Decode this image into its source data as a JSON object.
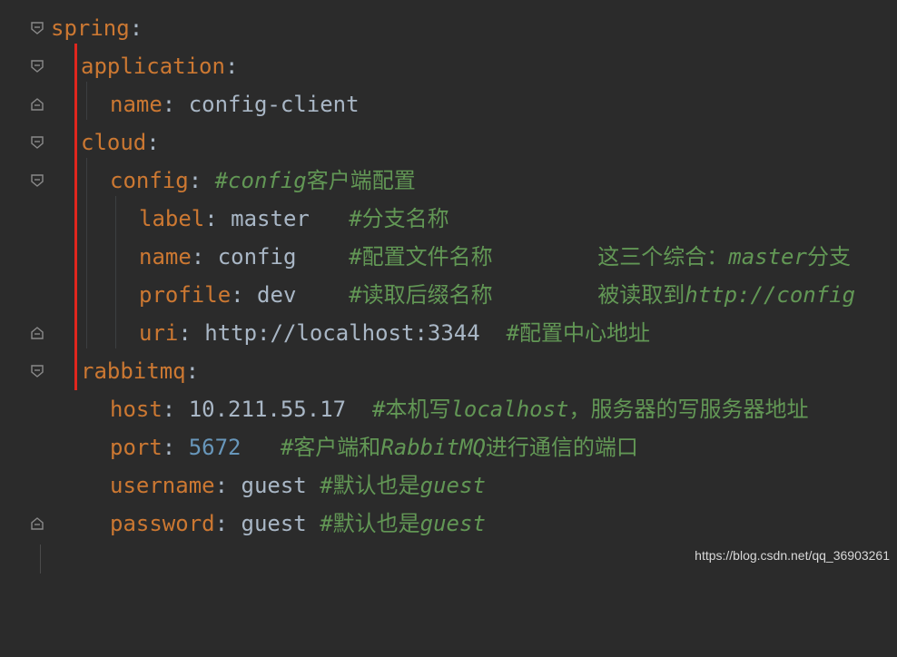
{
  "lines": [
    {
      "key": "spring",
      "colon": ":",
      "value": "",
      "comment": ""
    },
    {
      "key": "application",
      "colon": ":",
      "value": "",
      "comment": ""
    },
    {
      "key": "name",
      "colon": ":",
      "value": " config-client",
      "comment": ""
    },
    {
      "key": "cloud",
      "colon": ":",
      "value": "",
      "comment": ""
    },
    {
      "key": "config",
      "colon": ":",
      "value": " ",
      "comment_italic": "#config",
      "comment_rest": "客户端配置"
    },
    {
      "key": "label",
      "colon": ":",
      "value": " master   ",
      "comment": "#分支名称"
    },
    {
      "key": "name",
      "colon": ":",
      "value": " config    ",
      "comment": "#配置文件名称",
      "extra_plain": "        这三个综合：",
      "extra_italic": "master",
      "extra_tail": "分支"
    },
    {
      "key": "profile",
      "colon": ":",
      "value": " dev    ",
      "comment": "#读取后缀名称",
      "extra_plain": "        被读取到",
      "extra_italic": "http://config"
    },
    {
      "key": "uri",
      "colon": ":",
      "value": " http://localhost:3344  ",
      "comment": "#配置中心地址"
    },
    {
      "key": "rabbitmq",
      "colon": ":",
      "value": "",
      "comment": ""
    },
    {
      "key": "host",
      "colon": ":",
      "value": " 10.211.55.17  ",
      "comment_a": "#本机写",
      "comment_i": "localhost",
      "comment_b": "，服务器的写服务器地址"
    },
    {
      "key": "port",
      "colon": ":",
      "value": " ",
      "number": "5672",
      "pad": "   ",
      "comment_a": "#客户端和",
      "comment_i": "RabbitMQ",
      "comment_b": "进行通信的端口"
    },
    {
      "key": "username",
      "colon": ":",
      "value": " guest ",
      "comment_a": "#默认也是",
      "comment_i": "guest"
    },
    {
      "key": "password",
      "colon": ":",
      "value": " guest ",
      "comment_a": "#默认也是",
      "comment_i": "guest"
    }
  ],
  "watermark": "https://blog.csdn.net/qq_36903261",
  "colors": {
    "background": "#2b2b2b",
    "key": "#cc7832",
    "text": "#a9b7c6",
    "number": "#6897bb",
    "comment": "#629755",
    "marker": "#e0261e"
  }
}
